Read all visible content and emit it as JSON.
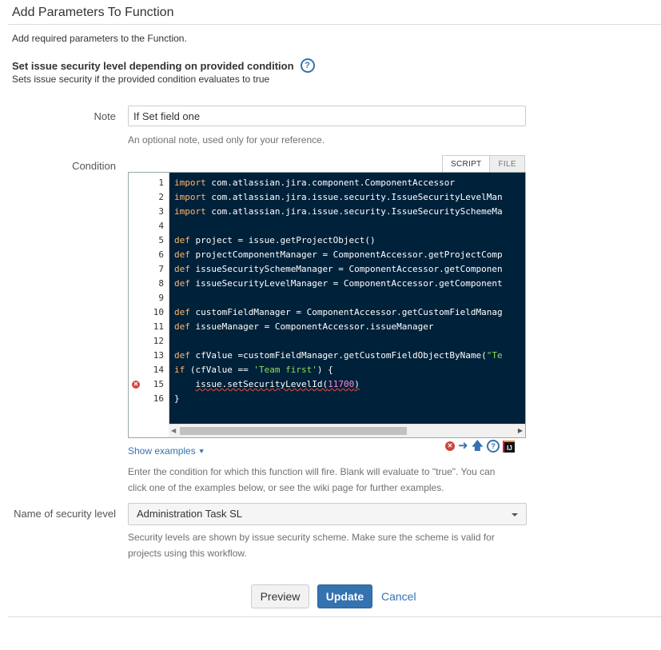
{
  "header": {
    "title": "Add Parameters To Function",
    "intro": "Add required parameters to the Function."
  },
  "function": {
    "name": "Set issue security level depending on provided condition",
    "help_icon": "question-circle-icon",
    "description": "Sets issue security if the provided condition evaluates to true"
  },
  "note": {
    "label": "Note",
    "value": "If Set field one",
    "hint": "An optional note, used only for your reference."
  },
  "condition": {
    "label": "Condition",
    "tabs": [
      "SCRIPT",
      "FILE"
    ],
    "active_tab": "SCRIPT",
    "line_numbers": [
      "1",
      "2",
      "3",
      "4",
      "5",
      "6",
      "7",
      "8",
      "9",
      "10",
      "11",
      "12",
      "13",
      "14",
      "15",
      "16"
    ],
    "error_line": "15",
    "code": [
      "import com.atlassian.jira.component.ComponentAccessor",
      "import com.atlassian.jira.issue.security.IssueSecurityLevelMan",
      "import com.atlassian.jira.issue.security.IssueSecuritySchemeMa",
      "",
      "def project = issue.getProjectObject()",
      "def projectComponentManager = ComponentAccessor.getProjectComp",
      "def issueSecuritySchemeManager = ComponentAccessor.getComponen",
      "def issueSecurityLevelManager = ComponentAccessor.getComponent",
      "",
      "def customFieldManager = ComponentAccessor.getCustomFieldManag",
      "def issueManager = ComponentAccessor.issueManager",
      "",
      "def cfValue =customFieldManager.getCustomFieldObjectByName(\"Te",
      "if (cfValue == 'Team first') {",
      "    issue.setSecurityLevelId(11700)",
      "}"
    ],
    "show_examples": "Show examples",
    "toolbar_icons": [
      "error-icon",
      "arrow-right-icon",
      "arrow-up-icon",
      "help-icon",
      "intellij-icon"
    ],
    "hint": "Enter the condition for which this function will fire. Blank will evaluate to \"true\". You can click one of the examples below, or see the wiki page for further examples."
  },
  "security_level": {
    "label": "Name of security level",
    "selected": "Administration Task SL",
    "hint": "Security levels are shown by issue security scheme. Make sure the scheme is valid for projects using this workflow."
  },
  "actions": {
    "preview": "Preview",
    "update": "Update",
    "cancel": "Cancel"
  },
  "colors": {
    "accent": "#3572b0",
    "editor_bg": "#00213a",
    "error": "#d04437"
  }
}
